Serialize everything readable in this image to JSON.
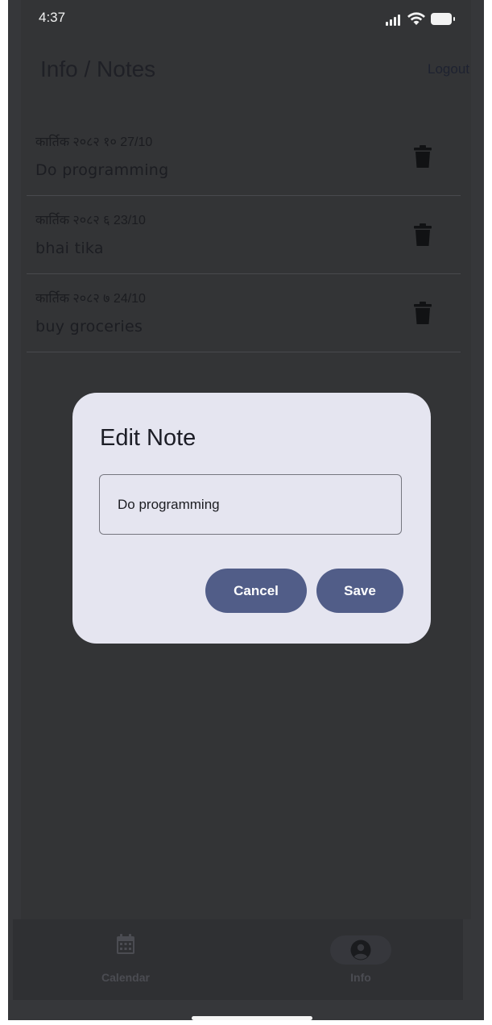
{
  "status_bar": {
    "time": "4:37"
  },
  "header": {
    "title": "Info / Notes",
    "logout_label": "Logout"
  },
  "notes": [
    {
      "date": "कार्तिक २०८२ १० 27/10",
      "text": "Do programming"
    },
    {
      "date": "कार्तिक २०८२ ६ 23/10",
      "text": "bhai tika"
    },
    {
      "date": "कार्तिक २०८२ ७ 24/10",
      "text": "buy groceries"
    }
  ],
  "dialog": {
    "title": "Edit Note",
    "input_value": "Do programming",
    "cancel_label": "Cancel",
    "save_label": "Save"
  },
  "bottom_nav": {
    "items": [
      {
        "label": "Calendar",
        "icon": "calendar-icon"
      },
      {
        "label": "Info",
        "icon": "account-circle-icon",
        "selected": true
      }
    ]
  },
  "colors": {
    "scrim_background": "#333436",
    "dialog_background": "#e5e5f0",
    "button_color": "#515d88"
  }
}
